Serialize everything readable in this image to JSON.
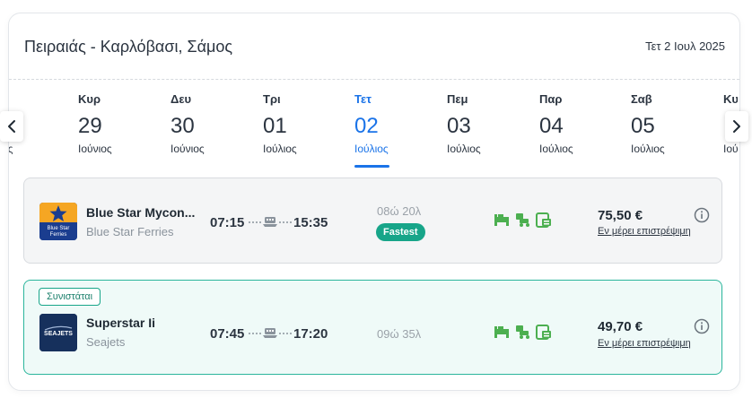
{
  "header": {
    "route": "Πειραιάς - Καρλόβασι, Σάμος",
    "date": "Τετ 2 Ιουλ 2025"
  },
  "days": [
    {
      "weekday": "",
      "day": "",
      "month": "ος",
      "active": false
    },
    {
      "weekday": "Κυρ",
      "day": "29",
      "month": "Ιούνιος",
      "active": false
    },
    {
      "weekday": "Δευ",
      "day": "30",
      "month": "Ιούνιος",
      "active": false
    },
    {
      "weekday": "Τρι",
      "day": "01",
      "month": "Ιούλιος",
      "active": false
    },
    {
      "weekday": "Τετ",
      "day": "02",
      "month": "Ιούλιος",
      "active": true
    },
    {
      "weekday": "Πεμ",
      "day": "03",
      "month": "Ιούλιος",
      "active": false
    },
    {
      "weekday": "Παρ",
      "day": "04",
      "month": "Ιούλιος",
      "active": false
    },
    {
      "weekday": "Σαβ",
      "day": "05",
      "month": "Ιούλιος",
      "active": false
    },
    {
      "weekday": "Κυ",
      "day": "",
      "month": "Ιού",
      "active": false
    }
  ],
  "trips": [
    {
      "vessel": "Blue Star Mycon...",
      "company": "Blue Star Ferries",
      "logo_text_1": "Blue Star",
      "logo_text_2": "Ferries",
      "depart": "07:15",
      "arrive": "15:35",
      "duration": "08ώ 20λ",
      "badge": "Fastest",
      "price": "75,50 €",
      "refund": "Εν μέρει επιστρέψιμη"
    },
    {
      "label": "Συνιστάται",
      "vessel": "Superstar Ii",
      "company": "Seajets",
      "logo_text_1": "SEAJETS",
      "depart": "07:45",
      "arrive": "17:20",
      "duration": "09ώ 35λ",
      "price": "49,70 €",
      "refund": "Εν μέρει επιστρέψιμη"
    }
  ],
  "colors": {
    "accent": "#1a73e8",
    "teal": "#17a589",
    "amenity": "#4caf50"
  },
  "icons": [
    "chevron-left-icon",
    "chevron-right-icon",
    "ferry-icon",
    "bed-icon",
    "car-icon",
    "ticket-icon",
    "info-icon",
    "star-icon"
  ]
}
